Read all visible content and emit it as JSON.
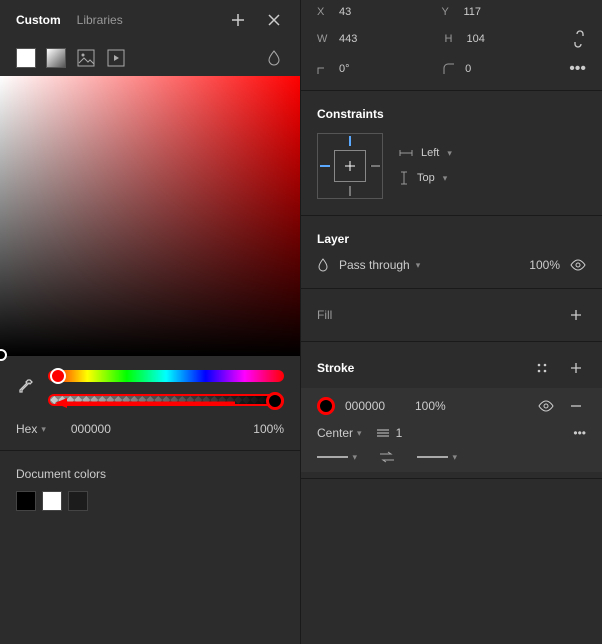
{
  "colorPanel": {
    "tabs": {
      "custom": "Custom",
      "libraries": "Libraries"
    },
    "hex": {
      "label": "Hex",
      "value": "000000",
      "opacity": "100%"
    },
    "docColors": {
      "title": "Document colors",
      "swatches": [
        "#000000",
        "#ffffff",
        "#1c1c1c"
      ]
    }
  },
  "transform": {
    "x": {
      "label": "X",
      "value": "43"
    },
    "y": {
      "label": "Y",
      "value": "117"
    },
    "w": {
      "label": "W",
      "value": "443"
    },
    "h": {
      "label": "H",
      "value": "104"
    },
    "rot": {
      "value": "0°"
    },
    "corner": {
      "value": "0"
    }
  },
  "constraints": {
    "title": "Constraints",
    "h": "Left",
    "v": "Top"
  },
  "layer": {
    "title": "Layer",
    "blend": "Pass through",
    "opacity": "100%"
  },
  "fill": {
    "title": "Fill"
  },
  "stroke": {
    "title": "Stroke",
    "hex": "000000",
    "opacity": "100%",
    "position": "Center",
    "weight": "1"
  }
}
